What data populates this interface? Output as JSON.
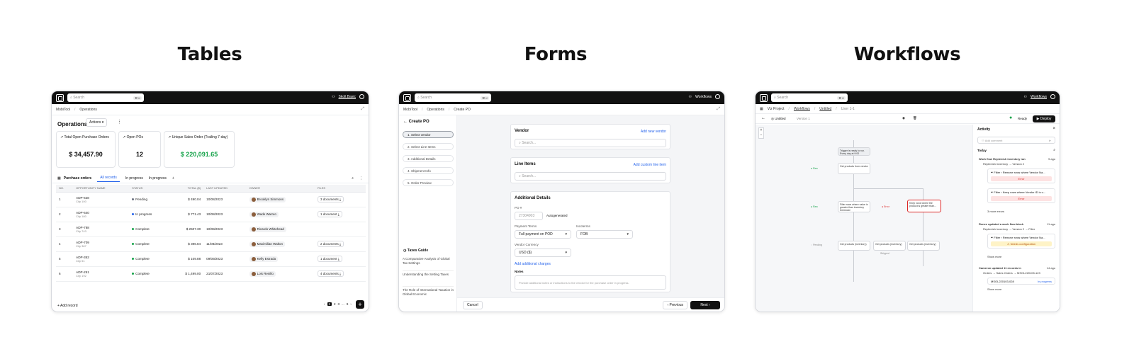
{
  "titles": {
    "tables": "Tables",
    "forms": "Forms",
    "workflows": "Workflows"
  },
  "colors": {
    "topbar": "#111111",
    "accent": "#2563eb",
    "success": "#16a34a",
    "danger": "#dc2626"
  },
  "tables": {
    "search_placeholder": "Search",
    "search_kbd": "⌘ K",
    "user": "Skoll.Basic",
    "crumbs": [
      "MobiTool",
      "Operations"
    ],
    "page_title": "Operations",
    "actions_label": "Actions",
    "kpis": [
      {
        "label": "Total Open Purchase Orders",
        "value": "$ 34,457.90"
      },
      {
        "label": "Open POs",
        "value": "12"
      },
      {
        "label": "Unique Sales Order (Trailing 7-day)",
        "value": "$ 220,091.65"
      }
    ],
    "list_title": "Purchase orders",
    "tabs": [
      "All records",
      "In progress",
      "In progress"
    ],
    "columns": [
      "NO.",
      "OPPORTUNITY NAME",
      "STATUS",
      "TOTAL ($)",
      "LAST UPDATED",
      "OWNER",
      "FILES"
    ],
    "rows": [
      {
        "no": "1",
        "name": "ADP-628",
        "sub": "City 100",
        "status": "Pending",
        "total": "$ 490.04",
        "updated": "10/08/2023",
        "owner": "Brooklyn Simmons",
        "files": "3 documents"
      },
      {
        "no": "2",
        "name": "ADP-640",
        "sub": "City 180",
        "status": "In progress",
        "total": "$ 771.43",
        "updated": "10/08/2023",
        "owner": "Wade Warren",
        "files": "1 document"
      },
      {
        "no": "3",
        "name": "ADP-788",
        "sub": "City 743",
        "status": "Complete",
        "total": "$ 2507.30",
        "updated": "10/08/2023",
        "owner": "Ricardo Whitehead",
        "files": ""
      },
      {
        "no": "4",
        "name": "ADP-709",
        "sub": "City 367",
        "status": "Complete",
        "total": "$ 396.84",
        "updated": "11/08/2023",
        "owner": "Maximilian Walton",
        "files": "2 documents"
      },
      {
        "no": "5",
        "name": "ADP-352",
        "sub": "City 51",
        "status": "Complete",
        "total": "$ 109.88",
        "updated": "09/09/2023",
        "owner": "Kelly Estrada",
        "files": "1 document"
      },
      {
        "no": "6",
        "name": "ADP-251",
        "sub": "City 192",
        "status": "Complete",
        "total": "$ 1,499.00",
        "updated": "21/07/2023",
        "owner": "Lois Renillo",
        "files": "4 documents"
      }
    ],
    "add_record": "Add record",
    "pages": [
      "1",
      "2",
      "3",
      "...",
      "9"
    ]
  },
  "forms": {
    "search_placeholder": "Search",
    "search_kbd": "⌘ K",
    "user": "Workflows",
    "crumbs": [
      "MobiTool",
      "Operations",
      "Create PO"
    ],
    "back_title": "Create PO",
    "steps": [
      "1. Select vendor",
      "2. Select Line Items",
      "3. Additional Details",
      "4. Shipment Info",
      "5. Order Preview"
    ],
    "guide_title": "Taxes Guide",
    "guides": [
      "A Comparative Analysis of Global Tax Settings",
      "Understanding the Setting Taxes",
      "The Role of International Taxation in Global Economic"
    ],
    "vendor": {
      "title": "Vendor",
      "link": "Add new vendor",
      "placeholder": "Search..."
    },
    "line_items": {
      "title": "Line Items",
      "link": "Add custom line item",
      "placeholder": "Search..."
    },
    "details": {
      "title": "Additional Details",
      "po_label": "PO #",
      "po_value": "27304903",
      "autogen": "Autogenerated",
      "payment_terms_label": "Payment Terms",
      "payment_terms_value": "Full payment on POD",
      "incoterms_label": "Incoterms",
      "incoterms_value": "FOB",
      "currency_label": "Vendor Currency",
      "currency_value": "USD ($)",
      "charges_link": "Add additional charges",
      "notes_label": "Notes",
      "notes_placeholder": "Provide additional notes or instructions to the vendor for the purchase order in progress."
    },
    "cancel": "Cancel",
    "previous": "Previous",
    "next": "Next"
  },
  "workflows": {
    "search_placeholder": "Search",
    "search_kbd": "⌘ K",
    "user": "Workflows",
    "crumbs": [
      "Viz Project",
      "Workflows",
      "Untitled",
      "User 1-1"
    ],
    "name": "Untitled",
    "version": "Version 1",
    "status": "Ready",
    "deploy": "Deploy",
    "activity_title": "Activity",
    "comment_placeholder": "Add comment",
    "today": "Today",
    "run_title": "Work flow Replenish inventory ran",
    "run_sub": "Replenish inventory → Version 2",
    "filter1": "Remove rows where Vendor Na...",
    "error": "Error",
    "filter2": "Keep rows where Vendor ID is u...",
    "show_more1": "3 more errors",
    "update_title": "Renee updated a work flow block",
    "update_sub": "Replenish inventory → Version 2 → Filter",
    "filter3": "Remove rows where Vendor Na...",
    "needs_config": "Needs configuration",
    "show_more2": "Show more",
    "update2_title": "Cameron updated 11 records in",
    "update2_sub": "Orders → Sales Orders → MSOL220105-123",
    "record_id": "MSOL220103-028",
    "record_status": "In progress",
    "show_more3": "Show more",
    "time1": "9 ago",
    "time2": "11 ago",
    "time3": "14 ago",
    "nodes": {
      "trigger": "Trigger is ready to run. Every day at 9:00",
      "n1": "Get products from vendor",
      "n2": "Filter rows where value is greater than inventory threshold",
      "n3": "Keep rows where the product is greater than...",
      "n4": "Get products (inventory)",
      "n5": "Get products (inventory)",
      "n6": "Get products (inventory)",
      "ok1": "Ran",
      "ok2": "Ran",
      "err": "Error",
      "pending": "Pending",
      "skipped": "Skipped"
    }
  }
}
